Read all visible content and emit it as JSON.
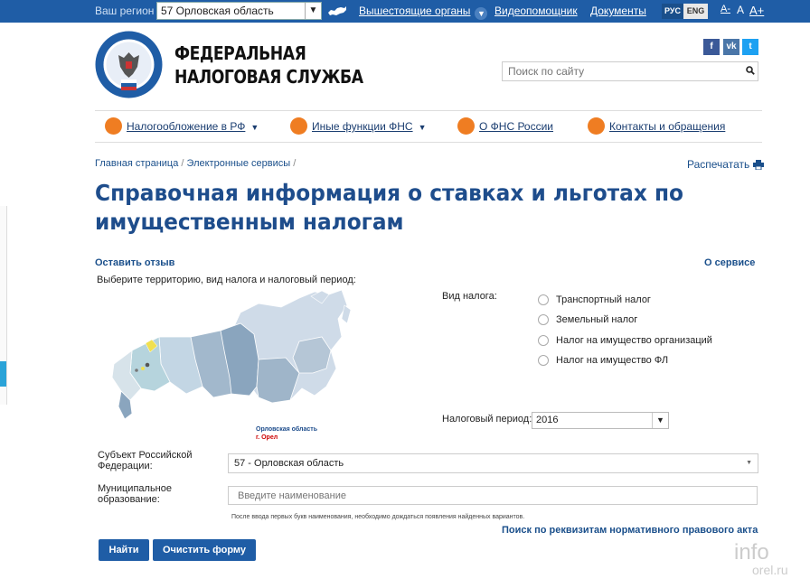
{
  "topbar": {
    "region_label": "Ваш регион",
    "region_value": "57 Орловская область",
    "links": [
      "Вышестоящие органы",
      "Видеопомощник",
      "Документы"
    ],
    "lang_ru": "РУС",
    "lang_en": "ENG",
    "font_sizes": [
      "A-",
      "A",
      "A+"
    ]
  },
  "header": {
    "org_line1": "ФЕДЕРАЛЬНАЯ",
    "org_line2": "НАЛОГОВАЯ СЛУЖБА",
    "search_placeholder": "Поиск по сайту",
    "social": [
      "f",
      "vk",
      "t"
    ]
  },
  "nav": [
    {
      "label": "Налогообложение в РФ",
      "icon": "tax-icon",
      "has_menu": true
    },
    {
      "label": "Иные функции ФНС",
      "icon": "menu-icon",
      "has_menu": true
    },
    {
      "label": "О ФНС России",
      "icon": "info-icon",
      "has_menu": false
    },
    {
      "label": "Контакты и обращения",
      "icon": "phone-icon",
      "has_menu": false
    }
  ],
  "breadcrumb": [
    "Главная страница",
    "/",
    "Электронные сервисы",
    "/"
  ],
  "print_label": "Распечатать",
  "page_title": "Справочная информация о ставках и льготах по имущественным налогам",
  "feedback_link": "Оставить отзыв",
  "about_link": "О сервисе",
  "select_hint": "Выберите территорию, вид налога и налоговый период:",
  "map_caption": {
    "region": "Орловская область",
    "city": "г. Орел"
  },
  "tax_type": {
    "label": "Вид налога:",
    "options": [
      "Транспортный налог",
      "Земельный налог",
      "Налог на имущество организаций",
      "Налог на имущество ФЛ"
    ]
  },
  "period": {
    "label": "Налоговый период:",
    "value": "2016"
  },
  "subject": {
    "label_line1": "Субъект Российской",
    "label_line2": "Федерации:",
    "value": "57 - Орловская область"
  },
  "municipality": {
    "label_line1": "Муниципальное",
    "label_line2": "образование:",
    "placeholder": "Введите наименование",
    "hint": "После ввода первых букв наименования, необходимо дождаться появления найденных вариантов."
  },
  "act_search_link": "Поиск по реквизитам нормативного правового акта",
  "buttons": {
    "find": "Найти",
    "clear": "Очистить форму"
  },
  "watermark": {
    "line1": "info",
    "line2": "orel.ru"
  },
  "colors": {
    "brand_blue": "#1f5da6",
    "accent_orange": "#ef7d22",
    "title_blue": "#1e4d8c"
  }
}
